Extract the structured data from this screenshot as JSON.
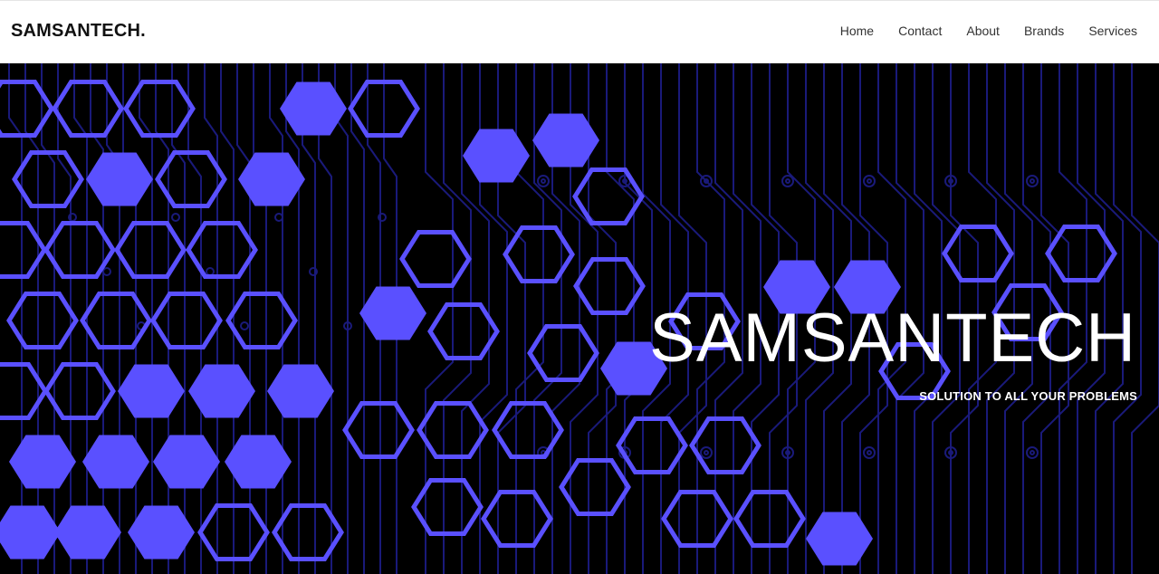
{
  "navbar": {
    "brand": "SAMSANTECH.",
    "links": [
      "Home",
      "Contact",
      "About",
      "Brands",
      "Services"
    ]
  },
  "hero": {
    "title": "SAMSANTECH",
    "subtitle": "SOLUTION TO ALL YOUR PROBLEMS"
  },
  "colors": {
    "accent": "#5a50ff",
    "circuit": "#1a1a7a",
    "background": "#000000"
  }
}
